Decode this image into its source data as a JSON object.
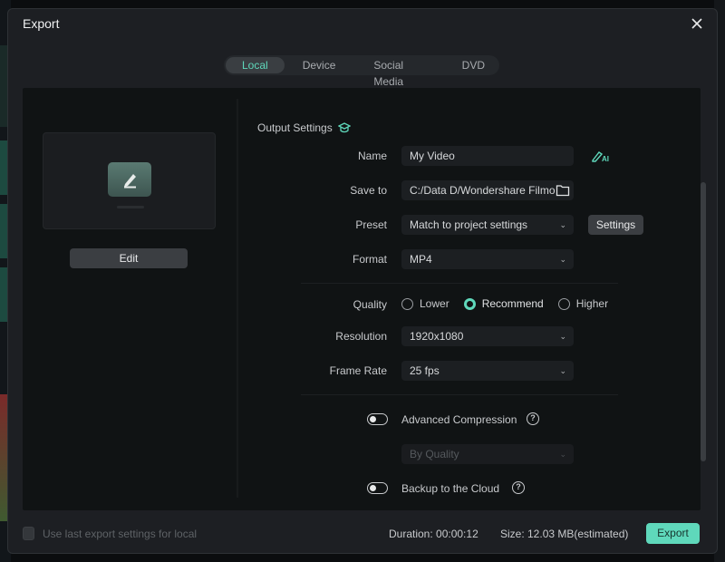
{
  "dialog": {
    "title": "Export",
    "close_icon": "close-icon"
  },
  "tabs": [
    {
      "label": "Local",
      "active": true
    },
    {
      "label": "Device",
      "active": false
    },
    {
      "label": "Social Media",
      "active": false
    },
    {
      "label": "DVD",
      "active": false
    }
  ],
  "preview": {
    "edit_label": "Edit",
    "icon": "pencil-icon"
  },
  "output_settings": {
    "title": "Output Settings",
    "title_icon": "graduation-cap-icon",
    "name": {
      "label": "Name",
      "value": "My Video",
      "ai_icon": "ai-rename-icon",
      "ai_text": "AI"
    },
    "save_to": {
      "label": "Save to",
      "value": "C:/Data D/Wondershare Filmo",
      "icon": "folder-icon"
    },
    "preset": {
      "label": "Preset",
      "value": "Match to project settings",
      "settings_label": "Settings"
    },
    "format": {
      "label": "Format",
      "value": "MP4"
    },
    "quality": {
      "label": "Quality",
      "options": [
        {
          "label": "Lower",
          "checked": false
        },
        {
          "label": "Recommend",
          "checked": true
        },
        {
          "label": "Higher",
          "checked": false
        }
      ]
    },
    "resolution": {
      "label": "Resolution",
      "value": "1920x1080"
    },
    "frame_rate": {
      "label": "Frame Rate",
      "value": "25 fps"
    },
    "advanced_compression": {
      "label": "Advanced Compression",
      "enabled": false,
      "mode_value": "By Quality"
    },
    "backup_cloud": {
      "label": "Backup to the Cloud",
      "enabled": false
    },
    "help_glyph": "?",
    "chevron_glyph": "⌄"
  },
  "footer": {
    "use_last_label": "Use last export settings for local",
    "use_last_checked": false,
    "duration": "Duration: 00:00:12",
    "size": "Size: 12.03 MB(estimated)",
    "export_label": "Export"
  },
  "colors": {
    "accent": "#5fd8bb",
    "dialog_bg": "#1d1f23",
    "panel_bg": "#101314"
  }
}
